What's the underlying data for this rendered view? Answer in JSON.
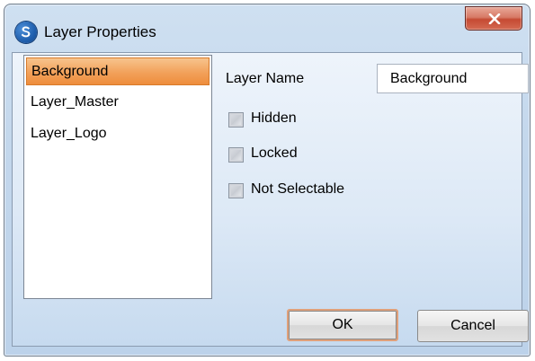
{
  "window": {
    "title": "Layer Properties",
    "app_icon": "app-logo-icon",
    "close_icon": "close-icon"
  },
  "layers": {
    "items": [
      {
        "label": "Background",
        "selected": true
      },
      {
        "label": "Layer_Master",
        "selected": false
      },
      {
        "label": "Layer_Logo",
        "selected": false
      }
    ]
  },
  "properties": {
    "layer_name_label": "Layer Name",
    "layer_name_value": "Background",
    "hidden_label": "Hidden",
    "hidden_checked": false,
    "locked_label": "Locked",
    "locked_checked": false,
    "not_selectable_label": "Not Selectable",
    "not_selectable_checked": false
  },
  "buttons": {
    "ok_label": "OK",
    "cancel_label": "Cancel"
  },
  "colors": {
    "selection": "#f2a15a",
    "close_button": "#c54a33",
    "window_frame": "#c3d7ec"
  }
}
